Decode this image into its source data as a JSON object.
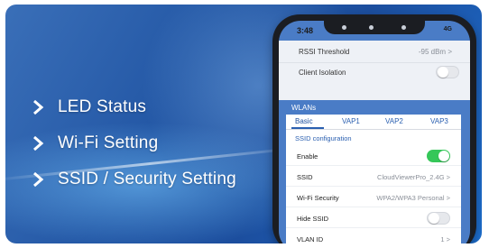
{
  "features": [
    {
      "label": "LED Status"
    },
    {
      "label": "Wi-Fi Setting"
    },
    {
      "label": "SSID / Security Setting"
    }
  ],
  "phone": {
    "status": {
      "time": "3:48",
      "signal": "4G"
    },
    "top_rows": {
      "rssi": {
        "label": "RSSI Threshold",
        "value": "-95 dBm >"
      },
      "client_isolation": {
        "label": "Client Isolation"
      }
    },
    "section_title": "WLANs",
    "tabs": [
      "Basic",
      "VAP1",
      "VAP2",
      "VAP3"
    ],
    "subheading": "SSID configuration",
    "rows": {
      "enable": {
        "label": "Enable",
        "on": true
      },
      "ssid": {
        "label": "SSID",
        "value": "CloudViewerPro_2.4G  >"
      },
      "wifi_security": {
        "label": "Wi-Fi Security",
        "value": "WPA2/WPA3 Personal  >"
      },
      "hide_ssid": {
        "label": "Hide SSID",
        "on": false
      },
      "vlan_id": {
        "label": "VLAN ID",
        "value": "1  >"
      }
    }
  },
  "colors": {
    "accent": "#2a5fb0",
    "toggle_on": "#35c759",
    "background": "#2458a6"
  }
}
